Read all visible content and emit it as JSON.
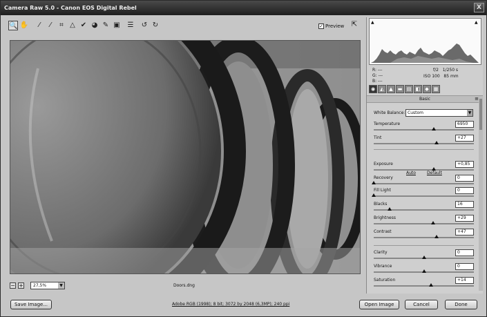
{
  "window": {
    "title": "Camera Raw 5.0  -  Canon EOS Digital Rebel",
    "close_glyph": "X"
  },
  "toolbar": {
    "tools": [
      {
        "name": "zoom-tool-icon",
        "glyph": "🔍"
      },
      {
        "name": "hand-tool-icon",
        "glyph": "✋"
      },
      {
        "name": "white-balance-tool-icon",
        "glyph": "⁄"
      },
      {
        "name": "color-sampler-tool-icon",
        "glyph": "⁄"
      },
      {
        "name": "crop-tool-icon",
        "glyph": "⌗"
      },
      {
        "name": "straighten-tool-icon",
        "glyph": "△"
      },
      {
        "name": "spot-removal-tool-icon",
        "glyph": "✔"
      },
      {
        "name": "red-eye-tool-icon",
        "glyph": "◕"
      },
      {
        "name": "adjustment-brush-icon",
        "glyph": "✎"
      },
      {
        "name": "graduated-filter-icon",
        "glyph": "▣"
      },
      {
        "name": "preferences-icon",
        "glyph": "☰"
      },
      {
        "name": "rotate-left-icon",
        "glyph": "↺"
      },
      {
        "name": "rotate-right-icon",
        "glyph": "↻"
      }
    ],
    "preview_label": "Preview",
    "preview_checked": "✓"
  },
  "image": {
    "zoom": "27,5%",
    "filename": "Doors.dng",
    "zoom_out": "−",
    "zoom_in": "+"
  },
  "histogram": {
    "r": "R: ---",
    "g": "G: ---",
    "b": "B: ---",
    "aperture": "f/2",
    "shutter": "1/250 s",
    "iso": "ISO 100",
    "focal": "85 mm"
  },
  "panel": {
    "title": "Basic",
    "tabs": [
      "◉",
      "◭",
      "▲",
      "▬",
      "▤",
      "◧",
      "◆",
      "▦"
    ],
    "white_balance_label": "White Balance:",
    "white_balance_value": "Custom",
    "auto": "Auto",
    "default": "Default",
    "controls": [
      {
        "label": "Temperature",
        "value": "6950",
        "pos": 0.6
      },
      {
        "label": "Tint",
        "value": "+27",
        "pos": 0.63
      },
      {
        "label": "Exposure",
        "value": "+0,85",
        "pos": 0.6
      },
      {
        "label": "Recovery",
        "value": "0",
        "pos": 0.0
      },
      {
        "label": "Fill Light",
        "value": "0",
        "pos": 0.0
      },
      {
        "label": "Blacks",
        "value": "16",
        "pos": 0.16
      },
      {
        "label": "Brightness",
        "value": "+29",
        "pos": 0.59
      },
      {
        "label": "Contrast",
        "value": "+47",
        "pos": 0.63
      },
      {
        "label": "Clarity",
        "value": "0",
        "pos": 0.5
      },
      {
        "label": "Vibrance",
        "value": "0",
        "pos": 0.5
      },
      {
        "label": "Saturation",
        "value": "+14",
        "pos": 0.57
      }
    ]
  },
  "footer": {
    "save": "Save Image...",
    "workflow": "Adobe RGB (1998); 8 bit; 3072 by 2048 (6,3MP); 240 ppi",
    "open": "Open Image",
    "cancel": "Cancel",
    "done": "Done"
  }
}
